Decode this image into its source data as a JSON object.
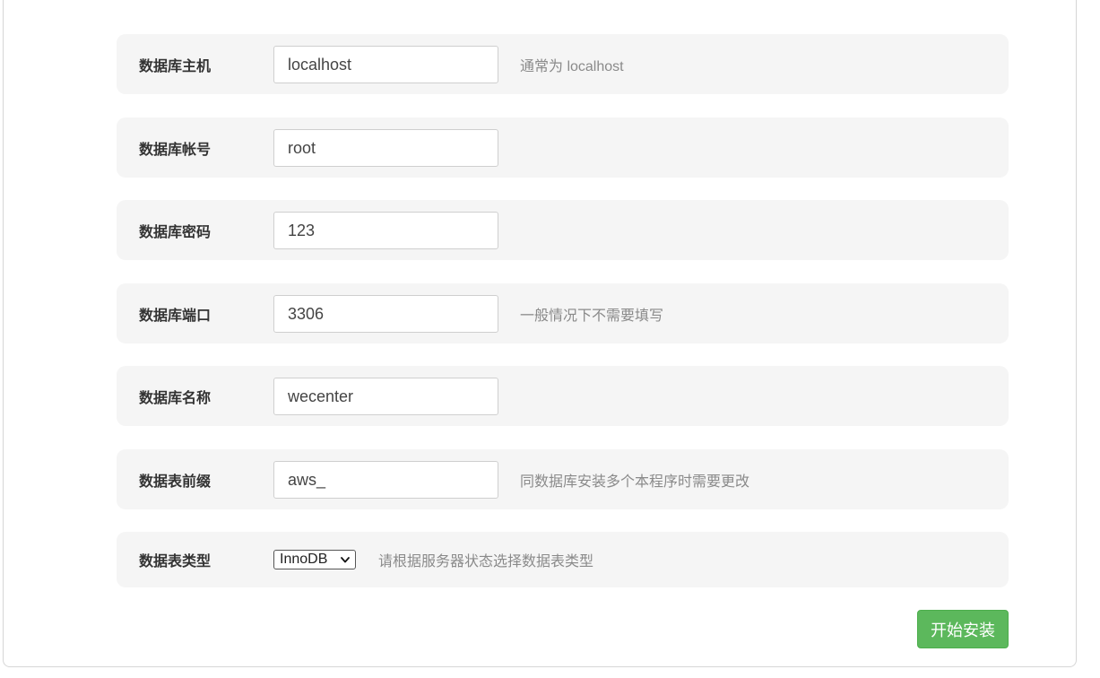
{
  "form": {
    "rows": [
      {
        "label": "数据库主机",
        "value": "localhost",
        "hint": "通常为 localhost"
      },
      {
        "label": "数据库帐号",
        "value": "root",
        "hint": ""
      },
      {
        "label": "数据库密码",
        "value": "123",
        "hint": ""
      },
      {
        "label": "数据库端口",
        "value": "3306",
        "hint": "一般情况下不需要填写"
      },
      {
        "label": "数据库名称",
        "value": "wecenter",
        "hint": ""
      },
      {
        "label": "数据表前缀",
        "value": "aws_",
        "hint": "同数据库安装多个本程序时需要更改"
      }
    ],
    "table_type": {
      "label": "数据表类型",
      "selected": "InnoDB",
      "hint": "请根据服务器状态选择数据表类型"
    },
    "submit_label": "开始安装"
  },
  "colors": {
    "row_background": "#f5f5f5",
    "submit_button": "#5cb85c",
    "hint_text": "#8a8a8a"
  },
  "icons": {
    "select_arrow": "chevron-down-icon"
  }
}
